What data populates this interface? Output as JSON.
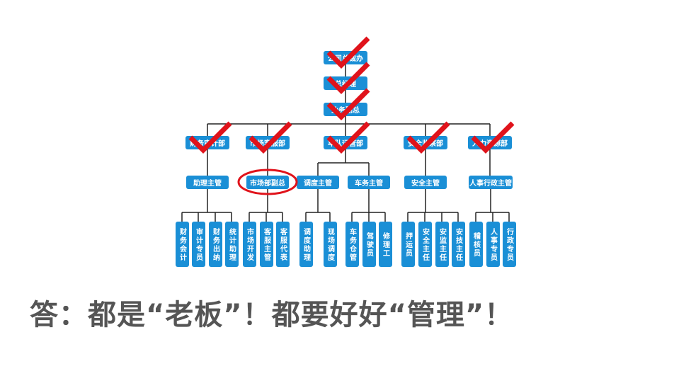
{
  "top": [
    "公司总裁办",
    "总经理",
    "业务副总"
  ],
  "departments": [
    {
      "name": "财务审计部",
      "managers": [
        {
          "name": "助理主管",
          "staff": [
            "财务会计",
            "审计专员",
            "财务出纳",
            "统计助理"
          ]
        }
      ]
    },
    {
      "name": "市场客服部",
      "managers": [
        {
          "name": "市场部副总",
          "staff": [
            "市场开发",
            "客服主管",
            "客服代表"
          ]
        }
      ]
    },
    {
      "name": "车队运营部",
      "managers": [
        {
          "name": "调度主管",
          "staff": [
            "调度助理",
            "现场调度"
          ]
        },
        {
          "name": "车务主管",
          "staff": [
            "车务仓管",
            "驾驶员",
            "修理工"
          ]
        }
      ]
    },
    {
      "name": "安全监察部",
      "managers": [
        {
          "name": "安全主管",
          "staff": [
            "押运员",
            "安全主任",
            "安监主任",
            "安技主任"
          ]
        }
      ]
    },
    {
      "name": "人力资源部",
      "managers": [
        {
          "name": "人事行政主管",
          "staff": [
            "稽核员",
            "人事专员",
            "行政专员"
          ]
        }
      ]
    }
  ],
  "caption": "答：都是“老板”！都要好好“管理”！",
  "colors": {
    "box": "#1a8fd6",
    "check": "#e0131b",
    "line": "#222222",
    "caption": "#555555"
  }
}
